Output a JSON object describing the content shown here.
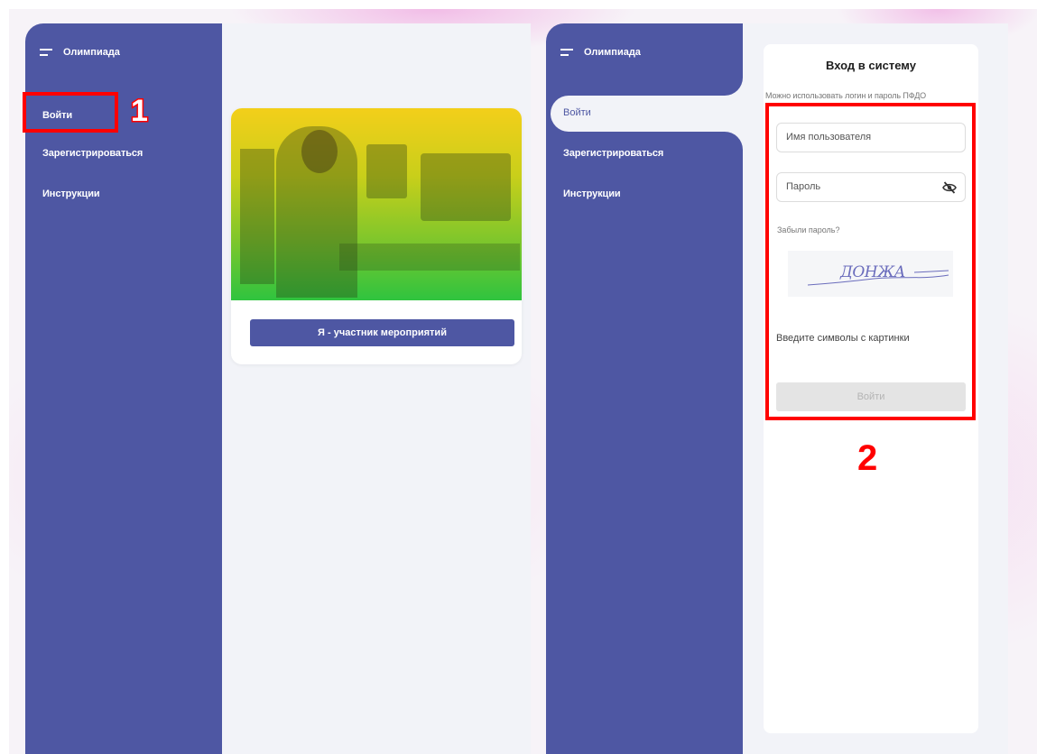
{
  "app": {
    "title": "Олимпиада"
  },
  "sidebar_left": {
    "items": [
      {
        "label": "Войти"
      },
      {
        "label": "Зарегистрироваться"
      },
      {
        "label": "Инструкции"
      }
    ]
  },
  "sidebar_right": {
    "items": [
      {
        "label": "Войти"
      },
      {
        "label": "Зарегистрироваться"
      },
      {
        "label": "Инструкции"
      }
    ]
  },
  "card": {
    "button_label": "Я - участник мероприятий"
  },
  "login": {
    "title": "Вход в систему",
    "subtitle": "Можно использовать логин и пароль ПФДО",
    "username_placeholder": "Имя пользователя",
    "password_placeholder": "Пароль",
    "forgot": "Забыли пароль?",
    "captcha_text": "ДОНЖА",
    "captcha_hint": "Введите символы с картинки",
    "submit_label": "Войти"
  },
  "annotations": {
    "marker_1": "1",
    "marker_2": "2"
  },
  "colors": {
    "sidebar": "#4e57a3",
    "content_bg": "#f2f3f8",
    "highlight": "#ff0000"
  },
  "icons": [
    "menu-icon",
    "eye-off-icon"
  ]
}
